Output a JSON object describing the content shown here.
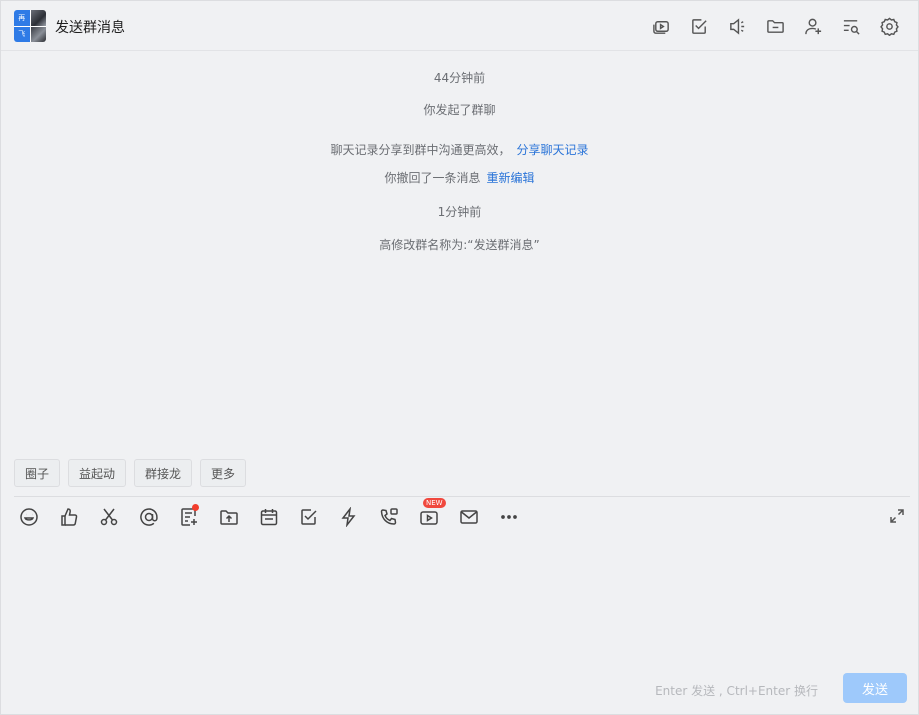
{
  "header": {
    "title": "发送群消息",
    "avatar_tiles": [
      "再",
      "飞"
    ],
    "icons": [
      "screen-share-icon",
      "todo-check-icon",
      "announcement-icon",
      "folder-icon",
      "add-member-icon",
      "search-history-icon",
      "settings-icon"
    ]
  },
  "messages": {
    "time1": "44分钟前",
    "started": "你发起了群聊",
    "share_text": "聊天记录分享到群中沟通更高效，",
    "share_link": "分享聊天记录",
    "recall_text": "你撤回了一条消息",
    "recall_link": "重新编辑",
    "time2": "1分钟前",
    "rename": "高修改群名称为:“发送群消息”"
  },
  "chips": [
    "圈子",
    "益起动",
    "群接龙",
    "更多"
  ],
  "toolbar": {
    "icons": [
      "emoji-icon",
      "thumbs-up-icon",
      "scissors-icon",
      "mention-icon",
      "doc-add-icon",
      "file-upload-icon",
      "calendar-icon",
      "task-check-icon",
      "lightning-icon",
      "call-icon",
      "live-video-icon",
      "mail-icon",
      "more-icon"
    ],
    "new_badge": "NEW"
  },
  "composer": {
    "hint": "Enter 发送 , Ctrl+Enter 换行",
    "send_label": "发送"
  },
  "colors": {
    "accent": "#2a74d8",
    "send_disabled": "#9ec9fb",
    "badge_red": "#f23d2c"
  }
}
